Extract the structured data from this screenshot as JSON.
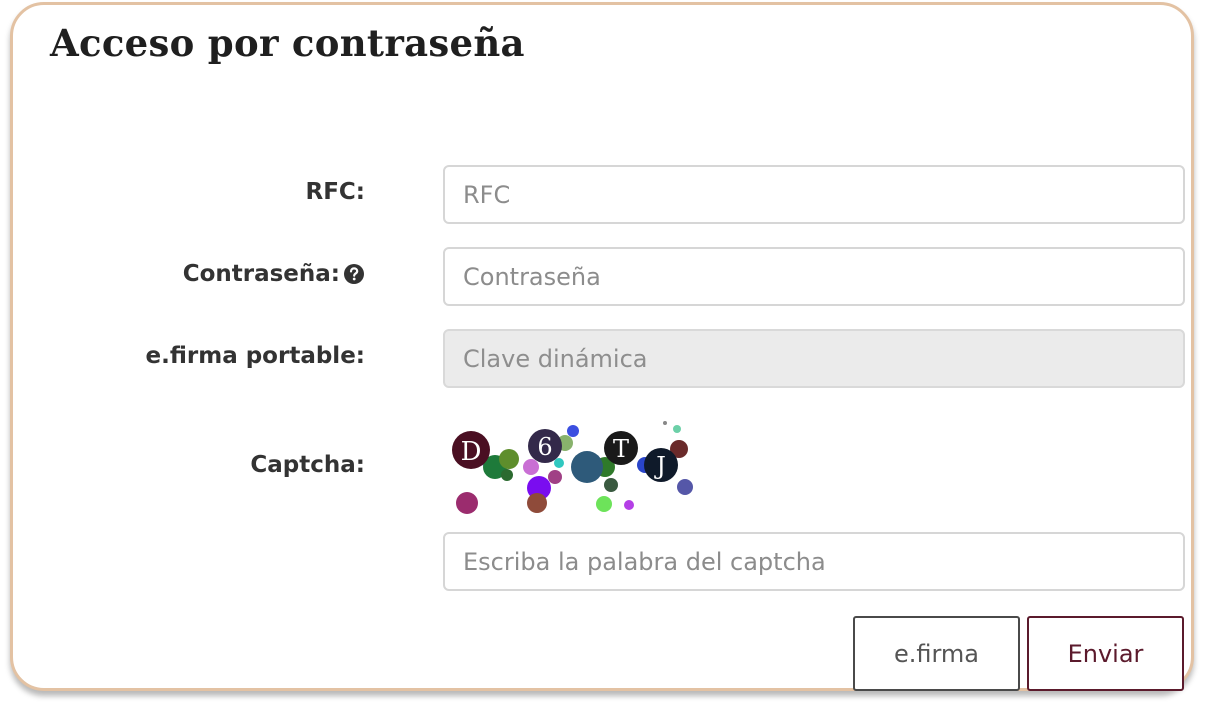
{
  "title": "Acceso por contraseña",
  "fields": {
    "rfc": {
      "label": "RFC:",
      "placeholder": "RFC"
    },
    "password": {
      "label": "Contraseña:",
      "placeholder": "Contraseña"
    },
    "efirma_portable": {
      "label": "e.firma portable:",
      "placeholder": "Clave dinámica"
    },
    "captcha": {
      "label": "Captcha:",
      "placeholder": "Escriba la palabra del captcha",
      "letters": [
        "D",
        "6",
        "T",
        "J"
      ]
    }
  },
  "buttons": {
    "efirma": "e.firma",
    "enviar": "Enviar"
  },
  "colors": {
    "card_border": "#e3c2a3",
    "primary": "#5b1a2c"
  },
  "icons": {
    "password_help": "question-circle-icon"
  }
}
